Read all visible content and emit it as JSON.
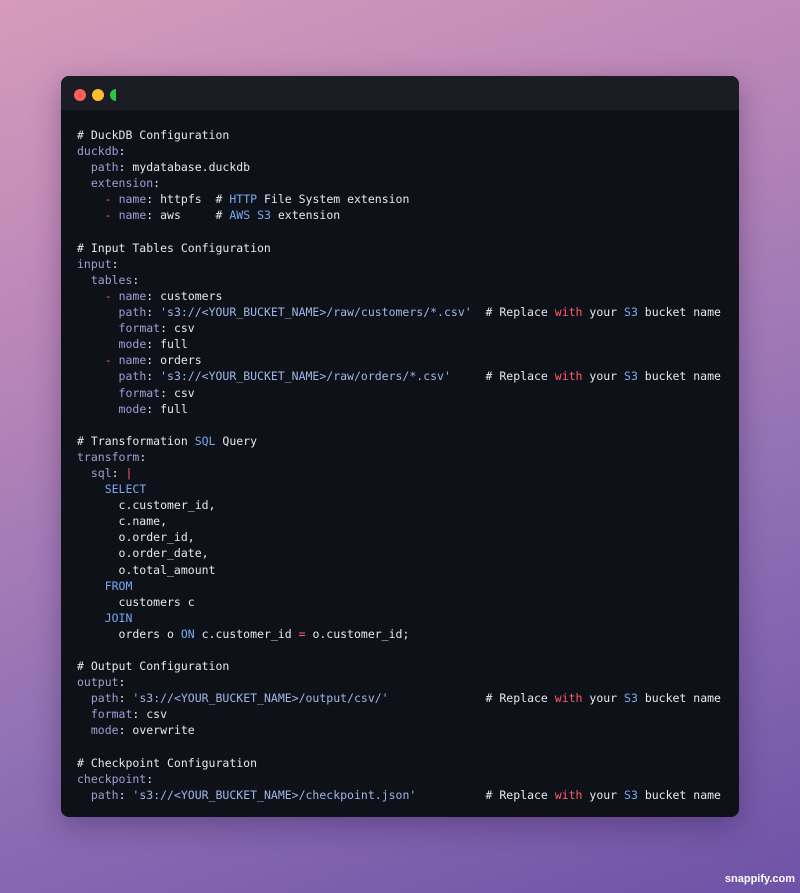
{
  "window": {
    "controls": [
      "close",
      "minimize",
      "maximize"
    ]
  },
  "code_lines": [
    [
      [
        "comment",
        "# DuckDB Configuration"
      ]
    ],
    [
      [
        "key",
        "duckdb"
      ],
      [
        "plain",
        ":"
      ]
    ],
    [
      [
        "plain",
        "  "
      ],
      [
        "key",
        "path"
      ],
      [
        "plain",
        ": mydatabase.duckdb"
      ]
    ],
    [
      [
        "plain",
        "  "
      ],
      [
        "key",
        "extension"
      ],
      [
        "plain",
        ":"
      ]
    ],
    [
      [
        "plain",
        "    "
      ],
      [
        "op",
        "-"
      ],
      [
        "plain",
        " "
      ],
      [
        "key",
        "name"
      ],
      [
        "plain",
        ": httpfs  # "
      ],
      [
        "kw",
        "HTTP"
      ],
      [
        "plain",
        " File System extension"
      ]
    ],
    [
      [
        "plain",
        "    "
      ],
      [
        "op",
        "-"
      ],
      [
        "plain",
        " "
      ],
      [
        "key",
        "name"
      ],
      [
        "plain",
        ": aws     # "
      ],
      [
        "kw",
        "AWS"
      ],
      [
        "plain",
        " "
      ],
      [
        "kw",
        "S3"
      ],
      [
        "plain",
        " extension"
      ]
    ],
    [],
    [
      [
        "comment",
        "# Input Tables Configuration"
      ]
    ],
    [
      [
        "key",
        "input"
      ],
      [
        "plain",
        ":"
      ]
    ],
    [
      [
        "plain",
        "  "
      ],
      [
        "key",
        "tables"
      ],
      [
        "plain",
        ":"
      ]
    ],
    [
      [
        "plain",
        "    "
      ],
      [
        "op",
        "-"
      ],
      [
        "plain",
        " "
      ],
      [
        "key",
        "name"
      ],
      [
        "plain",
        ": customers"
      ]
    ],
    [
      [
        "plain",
        "      "
      ],
      [
        "key",
        "path"
      ],
      [
        "plain",
        ": "
      ],
      [
        "str",
        "'s3://<YOUR_BUCKET_NAME>/raw/customers/*.csv'"
      ],
      [
        "plain",
        "  # Replace "
      ],
      [
        "op",
        "with"
      ],
      [
        "plain",
        " your "
      ],
      [
        "kw",
        "S3"
      ],
      [
        "plain",
        " bucket name"
      ]
    ],
    [
      [
        "plain",
        "      "
      ],
      [
        "key",
        "format"
      ],
      [
        "plain",
        ": csv"
      ]
    ],
    [
      [
        "plain",
        "      "
      ],
      [
        "key",
        "mode"
      ],
      [
        "plain",
        ": full"
      ]
    ],
    [
      [
        "plain",
        "    "
      ],
      [
        "op",
        "-"
      ],
      [
        "plain",
        " "
      ],
      [
        "key",
        "name"
      ],
      [
        "plain",
        ": orders"
      ]
    ],
    [
      [
        "plain",
        "      "
      ],
      [
        "key",
        "path"
      ],
      [
        "plain",
        ": "
      ],
      [
        "str",
        "'s3://<YOUR_BUCKET_NAME>/raw/orders/*.csv'"
      ],
      [
        "plain",
        "     # Replace "
      ],
      [
        "op",
        "with"
      ],
      [
        "plain",
        " your "
      ],
      [
        "kw",
        "S3"
      ],
      [
        "plain",
        " bucket name"
      ]
    ],
    [
      [
        "plain",
        "      "
      ],
      [
        "key",
        "format"
      ],
      [
        "plain",
        ": csv"
      ]
    ],
    [
      [
        "plain",
        "      "
      ],
      [
        "key",
        "mode"
      ],
      [
        "plain",
        ": full"
      ]
    ],
    [],
    [
      [
        "comment",
        "# Transformation "
      ],
      [
        "kw",
        "SQL"
      ],
      [
        "comment",
        " Query"
      ]
    ],
    [
      [
        "key",
        "transform"
      ],
      [
        "plain",
        ":"
      ]
    ],
    [
      [
        "plain",
        "  "
      ],
      [
        "key",
        "sql"
      ],
      [
        "plain",
        ": "
      ],
      [
        "op",
        "|"
      ]
    ],
    [
      [
        "plain",
        "    "
      ],
      [
        "kw",
        "SELECT"
      ]
    ],
    [
      [
        "plain",
        "      c.customer_id,"
      ]
    ],
    [
      [
        "plain",
        "      c.name,"
      ]
    ],
    [
      [
        "plain",
        "      o.order_id,"
      ]
    ],
    [
      [
        "plain",
        "      o.order_date,"
      ]
    ],
    [
      [
        "plain",
        "      o.total_amount"
      ]
    ],
    [
      [
        "plain",
        "    "
      ],
      [
        "kw",
        "FROM"
      ]
    ],
    [
      [
        "plain",
        "      customers c"
      ]
    ],
    [
      [
        "plain",
        "    "
      ],
      [
        "kw",
        "JOIN"
      ]
    ],
    [
      [
        "plain",
        "      orders o "
      ],
      [
        "kw",
        "ON"
      ],
      [
        "plain",
        " c.customer_id "
      ],
      [
        "op",
        "="
      ],
      [
        "plain",
        " o.customer_id;"
      ]
    ],
    [],
    [
      [
        "comment",
        "# Output Configuration"
      ]
    ],
    [
      [
        "key",
        "output"
      ],
      [
        "plain",
        ":"
      ]
    ],
    [
      [
        "plain",
        "  "
      ],
      [
        "key",
        "path"
      ],
      [
        "plain",
        ": "
      ],
      [
        "str",
        "'s3://<YOUR_BUCKET_NAME>/output/csv/'"
      ],
      [
        "plain",
        "              # Replace "
      ],
      [
        "op",
        "with"
      ],
      [
        "plain",
        " your "
      ],
      [
        "kw",
        "S3"
      ],
      [
        "plain",
        " bucket name"
      ]
    ],
    [
      [
        "plain",
        "  "
      ],
      [
        "key",
        "format"
      ],
      [
        "plain",
        ": csv"
      ]
    ],
    [
      [
        "plain",
        "  "
      ],
      [
        "key",
        "mode"
      ],
      [
        "plain",
        ": overwrite"
      ]
    ],
    [],
    [
      [
        "comment",
        "# Checkpoint Configuration"
      ]
    ],
    [
      [
        "key",
        "checkpoint"
      ],
      [
        "plain",
        ":"
      ]
    ],
    [
      [
        "plain",
        "  "
      ],
      [
        "key",
        "path"
      ],
      [
        "plain",
        ": "
      ],
      [
        "str",
        "'s3://<YOUR_BUCKET_NAME>/checkpoint.json'"
      ],
      [
        "plain",
        "          # Replace "
      ],
      [
        "op",
        "with"
      ],
      [
        "plain",
        " your "
      ],
      [
        "kw",
        "S3"
      ],
      [
        "plain",
        " bucket name"
      ]
    ]
  ],
  "watermark": "snappify.com"
}
